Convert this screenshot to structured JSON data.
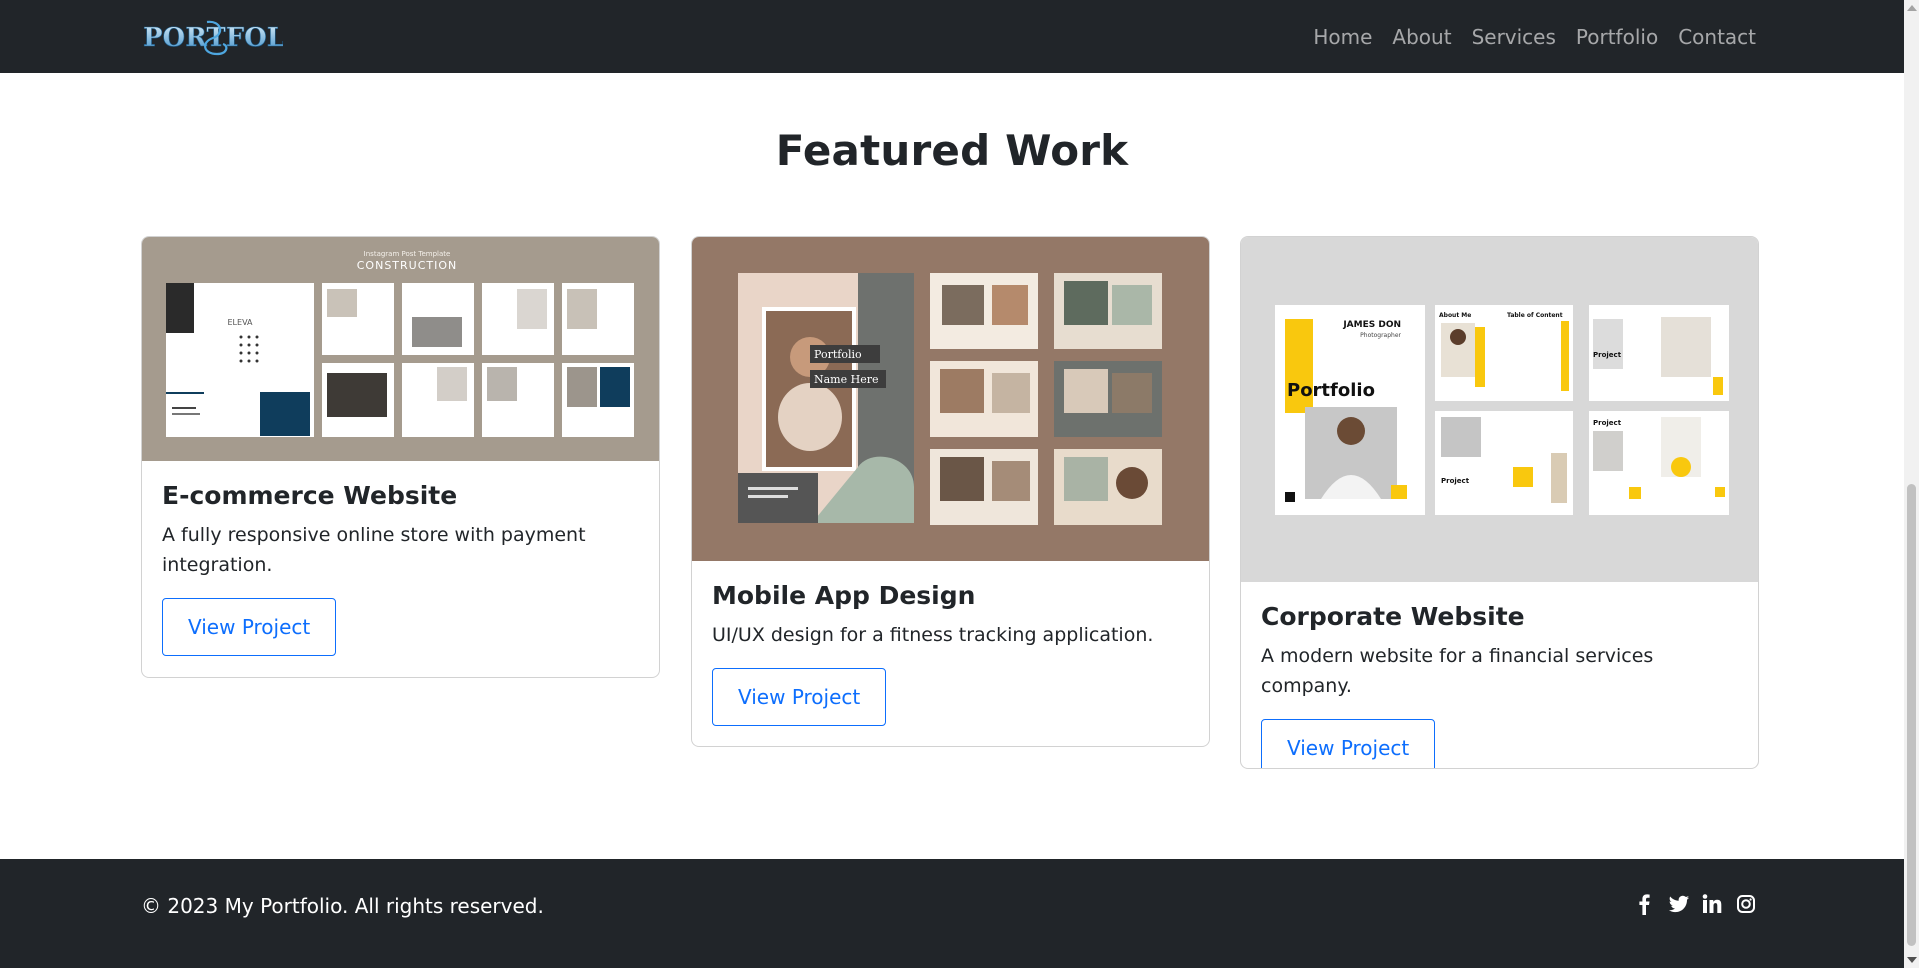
{
  "navbar": {
    "brand": "PORTFOLIO",
    "links": [
      "Home",
      "About",
      "Services",
      "Portfolio",
      "Contact"
    ]
  },
  "section": {
    "title": "Featured Work"
  },
  "projects": [
    {
      "title": "E-commerce Website",
      "description": "A fully responsive online store with payment integration.",
      "button": "View Project",
      "image_caption_small": "Instagram Post Template",
      "image_caption": "CONSTRUCTION",
      "image_brand": "ELEVA"
    },
    {
      "title": "Mobile App Design",
      "description": "UI/UX design for a fitness tracking application.",
      "button": "View Project",
      "image_label_1": "Portfolio",
      "image_label_2": "Name Here"
    },
    {
      "title": "Corporate Website",
      "description": "A modern website for a financial services company.",
      "button": "View Project",
      "image_name": "JAMES DON",
      "image_role": "Photographer",
      "image_heading": "Portfolio",
      "image_about": "About Me",
      "image_toc": "Table of Content",
      "image_project": "Project"
    }
  ],
  "footer": {
    "copyright": "© 2023 My Portfolio. All rights reserved.",
    "social": [
      "facebook-icon",
      "twitter-icon",
      "linkedin-icon",
      "instagram-icon"
    ]
  },
  "colors": {
    "navbar_bg": "#212529",
    "primary": "#0d6efd",
    "accent_yellow": "#f9c80e",
    "card1_bg": "#a59b8e",
    "card2_bg": "#947867",
    "card3_bg": "#d8d8d8"
  }
}
